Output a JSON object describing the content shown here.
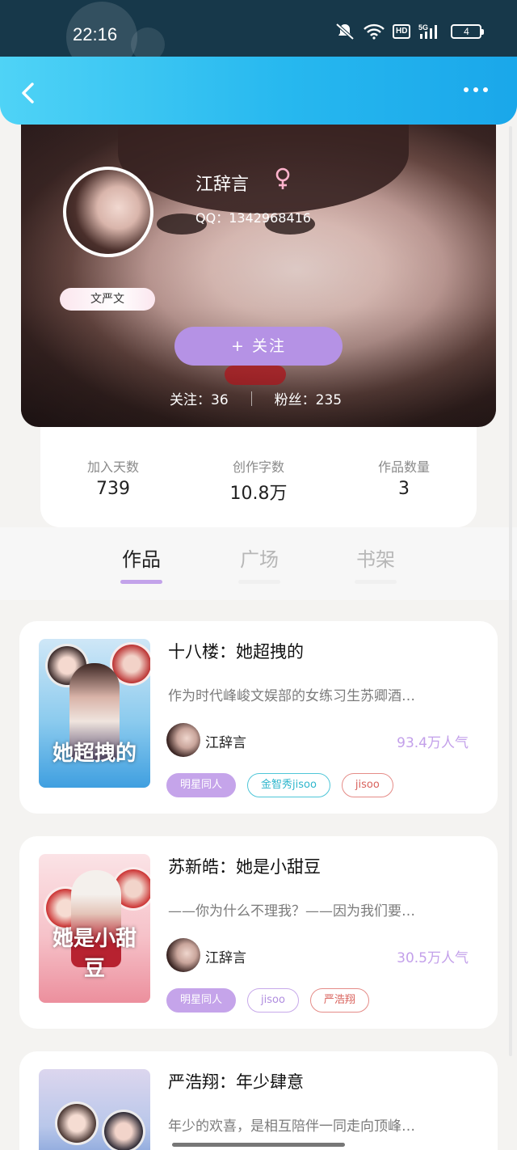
{
  "status_bar": {
    "time": "22:16",
    "network": "5G",
    "hd": "HD",
    "battery": "4"
  },
  "header": {
    "back_icon": "chevron-left-icon",
    "more_icon": "more-dots-icon"
  },
  "profile": {
    "username": "江辞言",
    "gender_icon": "female-icon",
    "qq": "QQ：1342968416",
    "badge": "文严文",
    "follow_button": "+  关注",
    "following_label": "关注：36",
    "fans_label": "粉丝：235"
  },
  "stats": [
    {
      "label": "加入天数",
      "value": "739"
    },
    {
      "label": "创作字数",
      "value": "10.8万"
    },
    {
      "label": "作品数量",
      "value": "3"
    }
  ],
  "tabs": [
    "作品",
    "广场",
    "书架"
  ],
  "active_tab": "作品",
  "works": [
    {
      "title": "十八楼：她超拽的",
      "description": "作为时代峰峻文娱部的女练习生苏卿酒…",
      "author": "江辞言",
      "popularity": "93.4万人气",
      "cover_text": "她超拽的",
      "tags": [
        "明星同人",
        "金智秀jisoo",
        "jisoo"
      ]
    },
    {
      "title": "苏新皓：她是小甜豆",
      "description": "——你为什么不理我？——因为我们要…",
      "author": "江辞言",
      "popularity": "30.5万人气",
      "cover_text": "她是小甜豆",
      "tags": [
        "明星同人",
        "jisoo",
        "严浩翔"
      ]
    },
    {
      "title": "严浩翔：年少肆意",
      "description": "年少的欢喜，是相互陪伴一同走向顶峰…",
      "author": "",
      "popularity": "",
      "cover_text": "",
      "tags": []
    }
  ],
  "colors": {
    "accent": "#c3a3ea",
    "header_start": "#4fd3f6",
    "header_end": "#1aa7ea",
    "follow_button": "#b592e5"
  }
}
